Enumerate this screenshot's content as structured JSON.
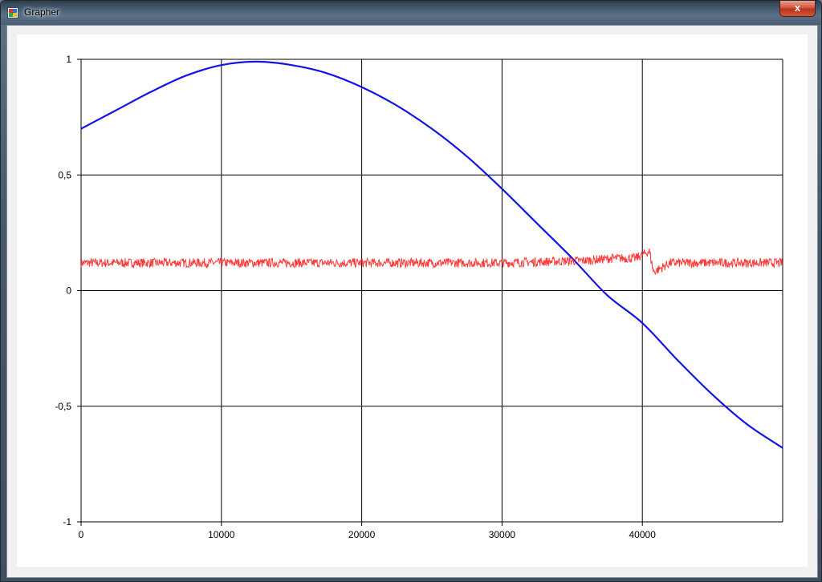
{
  "window": {
    "title": "Grapher",
    "close_glyph": "x",
    "icon": "application-icon"
  },
  "chart_data": {
    "type": "line",
    "title": "",
    "xlabel": "",
    "ylabel": "",
    "xlim": [
      0,
      50000
    ],
    "ylim": [
      -1,
      1
    ],
    "x_ticks": [
      "0",
      "10000",
      "20000",
      "30000",
      "40000"
    ],
    "x_tick_values": [
      0,
      10000,
      20000,
      30000,
      40000
    ],
    "y_ticks": [
      "1",
      "0,5",
      "0",
      "-0,5",
      "-1"
    ],
    "y_tick_values": [
      1,
      0.5,
      0,
      -0.5,
      -1
    ],
    "grid": true,
    "legend": "none",
    "series": [
      {
        "color": "#1414e6",
        "points": [
          [
            0,
            0.7
          ],
          [
            2500,
            0.78
          ],
          [
            5000,
            0.86
          ],
          [
            7500,
            0.93
          ],
          [
            10000,
            0.975
          ],
          [
            12500,
            0.99
          ],
          [
            15000,
            0.975
          ],
          [
            17500,
            0.94
          ],
          [
            20000,
            0.88
          ],
          [
            22500,
            0.8
          ],
          [
            25000,
            0.7
          ],
          [
            27500,
            0.58
          ],
          [
            30000,
            0.44
          ],
          [
            32500,
            0.29
          ],
          [
            35000,
            0.14
          ],
          [
            37500,
            -0.02
          ],
          [
            40000,
            -0.14
          ],
          [
            42500,
            -0.3
          ],
          [
            45000,
            -0.45
          ],
          [
            47500,
            -0.58
          ],
          [
            50000,
            -0.68
          ]
        ]
      },
      {
        "color": "#ff1a1a",
        "baseline": 0.12,
        "noise_amplitude": 0.02,
        "points": [
          [
            0,
            0.12
          ],
          [
            10000,
            0.12
          ],
          [
            20000,
            0.12
          ],
          [
            30000,
            0.12
          ],
          [
            36000,
            0.13
          ],
          [
            38000,
            0.14
          ],
          [
            39500,
            0.14
          ],
          [
            40500,
            0.17
          ],
          [
            40800,
            0.08
          ],
          [
            42000,
            0.12
          ],
          [
            50000,
            0.12
          ]
        ]
      }
    ]
  }
}
